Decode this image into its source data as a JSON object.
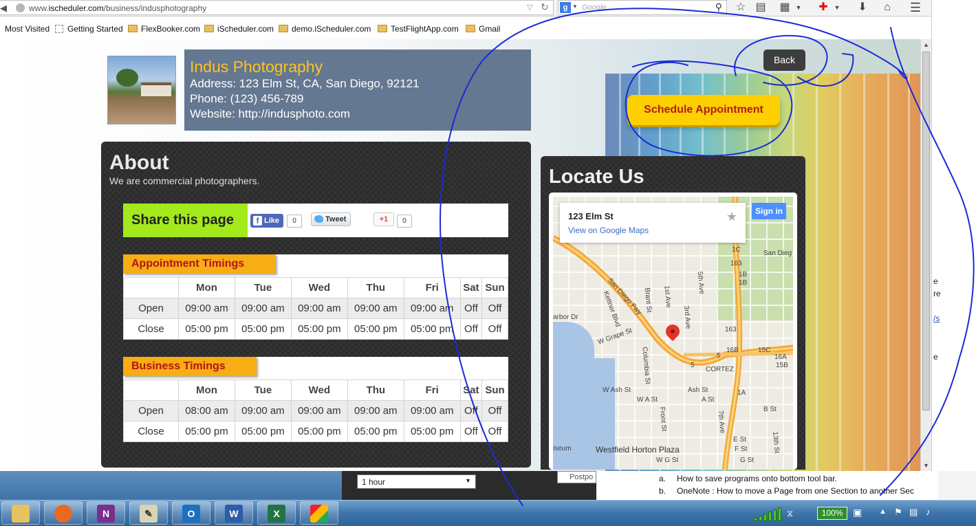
{
  "browser": {
    "url_prefix": "www.",
    "url_host": "ischeduler.com",
    "url_path": "/business/indusphotography",
    "search_placeholder": "Google",
    "bookmarks": [
      {
        "label": "Most Visited",
        "icon": "none"
      },
      {
        "label": "Getting Started",
        "icon": "dashed-page-icon"
      },
      {
        "label": "FlexBooker.com",
        "icon": "folder-icon"
      },
      {
        "label": "iScheduler.com",
        "icon": "folder-icon"
      },
      {
        "label": "demo.iScheduler.com",
        "icon": "folder-icon"
      },
      {
        "label": "TestFlightApp.com",
        "icon": "folder-icon"
      },
      {
        "label": "Gmail",
        "icon": "folder-icon"
      }
    ]
  },
  "business": {
    "name": "Indus Photography",
    "address": "Address: 123 Elm St, CA, San Diego, 92121",
    "phone": "Phone: (123) 456-789",
    "website": "Website: http://indusphoto.com"
  },
  "actions": {
    "back_label": "Back",
    "schedule_label": "Schedule Appointment"
  },
  "about": {
    "title": "About",
    "description": "We are commercial photographers."
  },
  "share": {
    "label": "Share this page",
    "fb_like": "Like",
    "fb_count": "0",
    "tweet": "Tweet",
    "gplus": "+1",
    "gplus_count": "0"
  },
  "appointment_timings": {
    "title": "Appointment Timings",
    "days": [
      "Mon",
      "Tue",
      "Wed",
      "Thu",
      "Fri",
      "Sat",
      "Sun"
    ],
    "rows": [
      {
        "label": "Open",
        "values": [
          "09:00 am",
          "09:00 am",
          "09:00 am",
          "09:00 am",
          "09:00 am",
          "Off",
          "Off"
        ]
      },
      {
        "label": "Close",
        "values": [
          "05:00 pm",
          "05:00 pm",
          "05:00 pm",
          "05:00 pm",
          "05:00 pm",
          "Off",
          "Off"
        ]
      }
    ]
  },
  "business_timings": {
    "title": "Business Timings",
    "days": [
      "Mon",
      "Tue",
      "Wed",
      "Thu",
      "Fri",
      "Sat",
      "Sun"
    ],
    "rows": [
      {
        "label": "Open",
        "values": [
          "08:00 am",
          "09:00 am",
          "09:00 am",
          "09:00 am",
          "09:00 am",
          "Off",
          "Off"
        ]
      },
      {
        "label": "Close",
        "values": [
          "05:00 pm",
          "05:00 pm",
          "05:00 pm",
          "05:00 pm",
          "05:00 pm",
          "Off",
          "Off"
        ]
      }
    ]
  },
  "locate": {
    "title": "Locate Us",
    "map_address": "123 Elm St",
    "map_link": "View on Google Maps",
    "sign_in": "Sign in",
    "labels": {
      "san_diego_fwy": "San Diego Fwy",
      "kettner": "Kettner Blvd",
      "brant": "Brant St",
      "first_ave": "1st Ave",
      "third_ave": "3rd Ave",
      "fifth_ave": "5th Ave",
      "grape": "W Grape St",
      "columbia": "Columbia St",
      "harbor": "arbor Dr",
      "cortez": "CORTEZ",
      "ash_w": "W Ash St",
      "ash": "Ash St",
      "a_w": "W A St",
      "a": "A St",
      "b": "B St",
      "front": "Front St",
      "seventh": "7th Ave",
      "e": "E St",
      "f": "F St",
      "g": "G St",
      "g_w": "W G St",
      "thirteenth": "13th St",
      "westfield": "Westfield Horton Plaza",
      "museum": "iseum",
      "san_diego": "San Dieg",
      "route_163a": "163",
      "route_163b": "163",
      "i5a": "5",
      "i5b": "5",
      "exit_1c": "1C",
      "exit_1b": "1B",
      "exit_1b2": "1B",
      "exit_16b": "16B",
      "exit_15c": "15C",
      "exit_16a": "16A",
      "exit_15b": "15B",
      "exit_1a": "1A"
    }
  },
  "background_app": {
    "duration": "1 hour",
    "postpone": "Postpo",
    "doc_lines": [
      {
        "num": "a.",
        "text": "How to save programs onto bottom tool bar."
      },
      {
        "num": "b.",
        "text": "OneNote : How to move a Page from one Section to another Sec"
      }
    ]
  },
  "taskbar": {
    "apps": [
      "explorer-icon",
      "firefox-icon",
      "onenote-icon",
      "paint-icon",
      "outlook-icon",
      "word-icon",
      "excel-icon",
      "rubik-icon"
    ],
    "battery": "100%"
  },
  "colors": {
    "biz_name": "#ffc21f",
    "biz_bg": "#657891",
    "schedule_bg": "#ffd000",
    "schedule_text": "#b21c1c",
    "share_label_bg": "#a2ea1c",
    "timing_tab_bg": "#f7ad14",
    "timing_tab_text": "#b01515",
    "panel_bg": "#303030",
    "annotation_ink": "#1a2bd6"
  }
}
